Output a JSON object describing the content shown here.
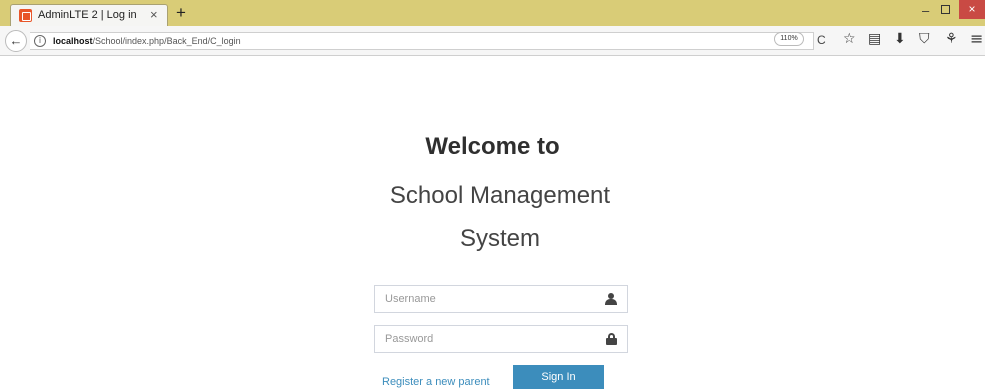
{
  "browser": {
    "tab": {
      "title": "AdminLTE 2 | Log in",
      "close_glyph": "×"
    },
    "new_tab_glyph": "+",
    "window": {
      "minimize_glyph": "–",
      "close_glyph": "×"
    },
    "url": {
      "host": "localhost",
      "path": "/School/index.php/Back_End/C_login"
    },
    "zoom": "110%",
    "icons": {
      "back": "←",
      "info": "i",
      "reload": "C",
      "bookmark_star": "☆",
      "reader": "▤",
      "download": "⬇",
      "pocket": "⛉",
      "extension": "⚘",
      "menu": "≡"
    }
  },
  "login": {
    "title": "Welcome to",
    "subtitle": "School Management System",
    "username_placeholder": "Username",
    "password_placeholder": "Password",
    "register_link": "Register a new parent",
    "signin_label": "Sign In"
  },
  "colors": {
    "accent": "#3c8dbc",
    "titlebar": "#d9cc77",
    "close_button": "#c94a44"
  }
}
